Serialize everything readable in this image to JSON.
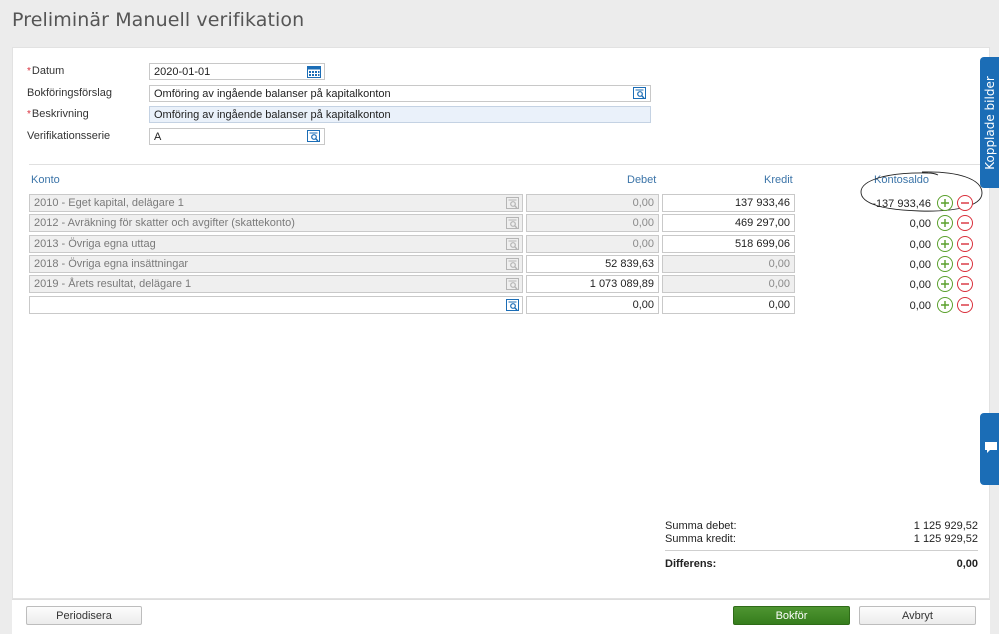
{
  "title": "Preliminär Manuell verifikation",
  "form": {
    "datum_label": "Datum",
    "datum_value": "2020-01-01",
    "bokforingsforslag_label": "Bokföringsförslag",
    "bokforingsforslag_value": "Omföring av ingående balanser på kapitalkonton",
    "beskrivning_label": "Beskrivning",
    "beskrivning_value": "Omföring av ingående balanser på kapitalkonton",
    "verifikationsserie_label": "Verifikationsserie",
    "verifikationsserie_value": "A",
    "required_mark": "*"
  },
  "table": {
    "headers": {
      "konto": "Konto",
      "debet": "Debet",
      "kredit": "Kredit",
      "kontosaldo": "Kontosaldo"
    },
    "rows": [
      {
        "konto": "2010 - Eget kapital, delägare 1",
        "debet": "0,00",
        "kredit": "137 933,46",
        "saldo": "-137 933,46"
      },
      {
        "konto": "2012 - Avräkning för skatter och avgifter (skattekonto)",
        "debet": "0,00",
        "kredit": "469 297,00",
        "saldo": "0,00"
      },
      {
        "konto": "2013 - Övriga egna uttag",
        "debet": "0,00",
        "kredit": "518 699,06",
        "saldo": "0,00"
      },
      {
        "konto": "2018 - Övriga egna insättningar",
        "debet": "52 839,63",
        "kredit": "0,00",
        "saldo": "0,00"
      },
      {
        "konto": "2019 - Årets resultat, delägare 1",
        "debet": "1 073 089,89",
        "kredit": "0,00",
        "saldo": "0,00"
      },
      {
        "konto": "",
        "debet": "0,00",
        "kredit": "0,00",
        "saldo": "0,00"
      }
    ]
  },
  "summary": {
    "summa_debet_label": "Summa debet:",
    "summa_debet_value": "1 125 929,52",
    "summa_kredit_label": "Summa kredit:",
    "summa_kredit_value": "1 125 929,52",
    "differens_label": "Differens:",
    "differens_value": "0,00"
  },
  "buttons": {
    "periodisera": "Periodisera",
    "bokfor": "Bokför",
    "avbryt": "Avbryt"
  },
  "side_tabs": {
    "kopplade_bilder": "Kopplade bilder"
  },
  "colors": {
    "accent_blue": "#1b6db6",
    "header_blue": "#3b74a8",
    "primary_green": "#4e9531",
    "plus_green": "#5aa02c",
    "minus_red": "#d9303c"
  },
  "icons": [
    "calendar-icon",
    "lookup-icon",
    "plus-icon",
    "minus-icon",
    "chat-icon"
  ]
}
